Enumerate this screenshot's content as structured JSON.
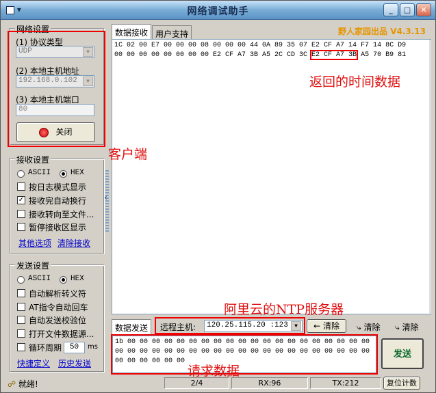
{
  "window": {
    "title": "网络调试助手",
    "sysmenu": "▾"
  },
  "brand": {
    "text": "野人家园出品",
    "version": "V4.3.13"
  },
  "network": {
    "title": "网络设置",
    "protocol_label": "(1) 协议类型",
    "protocol_value": "UDP",
    "host_label": "(2) 本地主机地址",
    "host_value": "192.168.0.102",
    "port_label": "(3) 本地主机端口",
    "port_value": "80",
    "close_button": "关闭"
  },
  "receive": {
    "title": "接收设置",
    "ascii": "ASCII",
    "hex": "HEX",
    "options": [
      "按日志模式显示",
      "接收完自动换行",
      "接收转向至文件...",
      "暂停接收区显示"
    ],
    "other_link": "其他选项",
    "clear_link": "清除接收"
  },
  "send": {
    "title": "发送设置",
    "ascii": "ASCII",
    "hex": "HEX",
    "options": [
      "自动解析转义符",
      "AT指令自动回车",
      "自动发送校验位",
      "打开文件数据源..."
    ],
    "cycle_label": "循环周期",
    "cycle_value": "50",
    "cycle_unit": "ms",
    "shortcut_link": "快捷定义",
    "history_link": "历史发送"
  },
  "tabs": {
    "receive": "数据接收",
    "user": "用户支持"
  },
  "received": {
    "line1": "1C 02 00 E7 00 00 00 08 00 00 00 44 0A 89 35 07 E2 CF A7 14 F7 14 8C D9",
    "line2_pre": "00 00 00 00 00 00 00 00 E2 CF A7 3B A5 2C CD 3C ",
    "line2_hl": "E2 CF A7 3B",
    "line2_post": " A5 70 B9 81"
  },
  "bottom": {
    "send_tab": "数据发送",
    "remote_label": "远程主机:",
    "remote_value": "120.25.115.20 :123",
    "clear1": "清除",
    "clear2": "清除",
    "clear3": "清除",
    "send_button": "发送",
    "send_data": "1b 00 00 00 00 00 00 00 00 00 00 00 00 00 00 00 00 00 00 00 00 00 00 00 00 00 00 00 00 00 00 00 00 00 00 00 00 00 00 00 00 00 00 00 00 00 00 00"
  },
  "status": {
    "ready": "就绪!",
    "page": "2/4",
    "rx": "RX:96",
    "tx": "TX:212",
    "reset": "复位计数"
  },
  "annotations": {
    "client": "客户端",
    "time_data": "返回的时间数据",
    "ntp": "阿里云的NTP服务器",
    "request": "请求数据"
  }
}
